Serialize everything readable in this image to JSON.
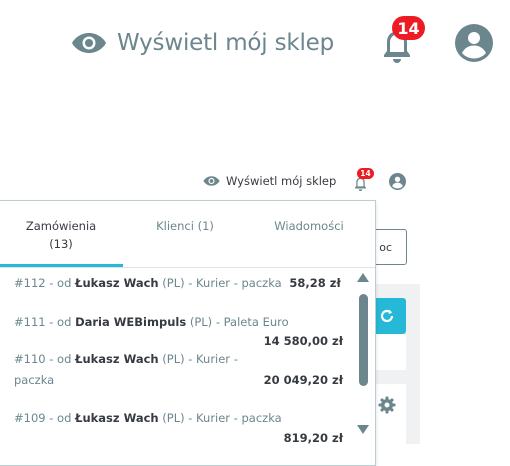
{
  "header": {
    "view_shop_label": "Wyświetl mój sklep",
    "notification_count": "14"
  },
  "tabs": [
    {
      "label": "Zamówienia",
      "count": "(13)"
    },
    {
      "label": "Klienci (1)"
    },
    {
      "label": "Wiadomości"
    }
  ],
  "orders": [
    {
      "id": "#112",
      "from": "- od",
      "customer": "Łukasz Wach",
      "details": "(PL) - Kurier - paczka",
      "amount": "58,28 zł"
    },
    {
      "id": "#111",
      "from": "- od",
      "customer": "Daria WEBimpuls",
      "details": "(PL) - Paleta Euro",
      "amount": "14 580,00 zł"
    },
    {
      "id": "#110",
      "from": "- od",
      "customer": "Łukasz Wach",
      "details": "(PL) - Kurier -",
      "details2": "paczka",
      "amount": "20 049,20 zł"
    },
    {
      "id": "#109",
      "from": "- od",
      "customer": "Łukasz Wach",
      "details": "(PL) - Kurier - paczka",
      "amount": "819,20 zł"
    }
  ],
  "background": {
    "button_label": "oc"
  },
  "colors": {
    "accent": "#25b9d7",
    "badge": "#ed1c24",
    "muted": "#6c868e",
    "text": "#363a41"
  }
}
